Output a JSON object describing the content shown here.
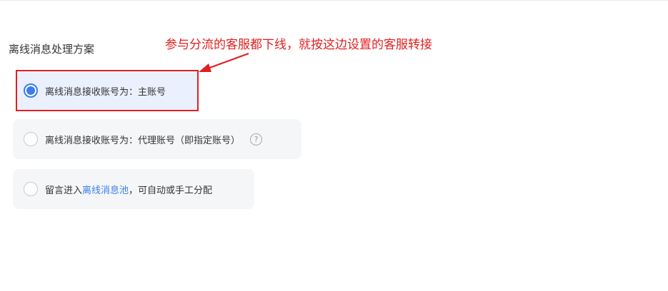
{
  "section": {
    "title": "离线消息处理方案"
  },
  "annotation": {
    "text": "参与分流的客服都下线，就按这边设置的客服转接",
    "color": "#e02020"
  },
  "options": [
    {
      "label": "离线消息接收账号为：主账号",
      "selected": true
    },
    {
      "label": "离线消息接收账号为：代理账号（即指定账号）",
      "selected": false,
      "help_icon": "question-circle-icon"
    },
    {
      "label_prefix": "留言进入",
      "link": "离线消息池",
      "label_suffix": "，可自动或手工分配",
      "selected": false
    }
  ],
  "help_glyph": "?",
  "colors": {
    "accent": "#3b7cf0",
    "option_bg": "#f5f6f8",
    "selected_bg": "#eaf0fd",
    "annotation": "#e02020"
  }
}
